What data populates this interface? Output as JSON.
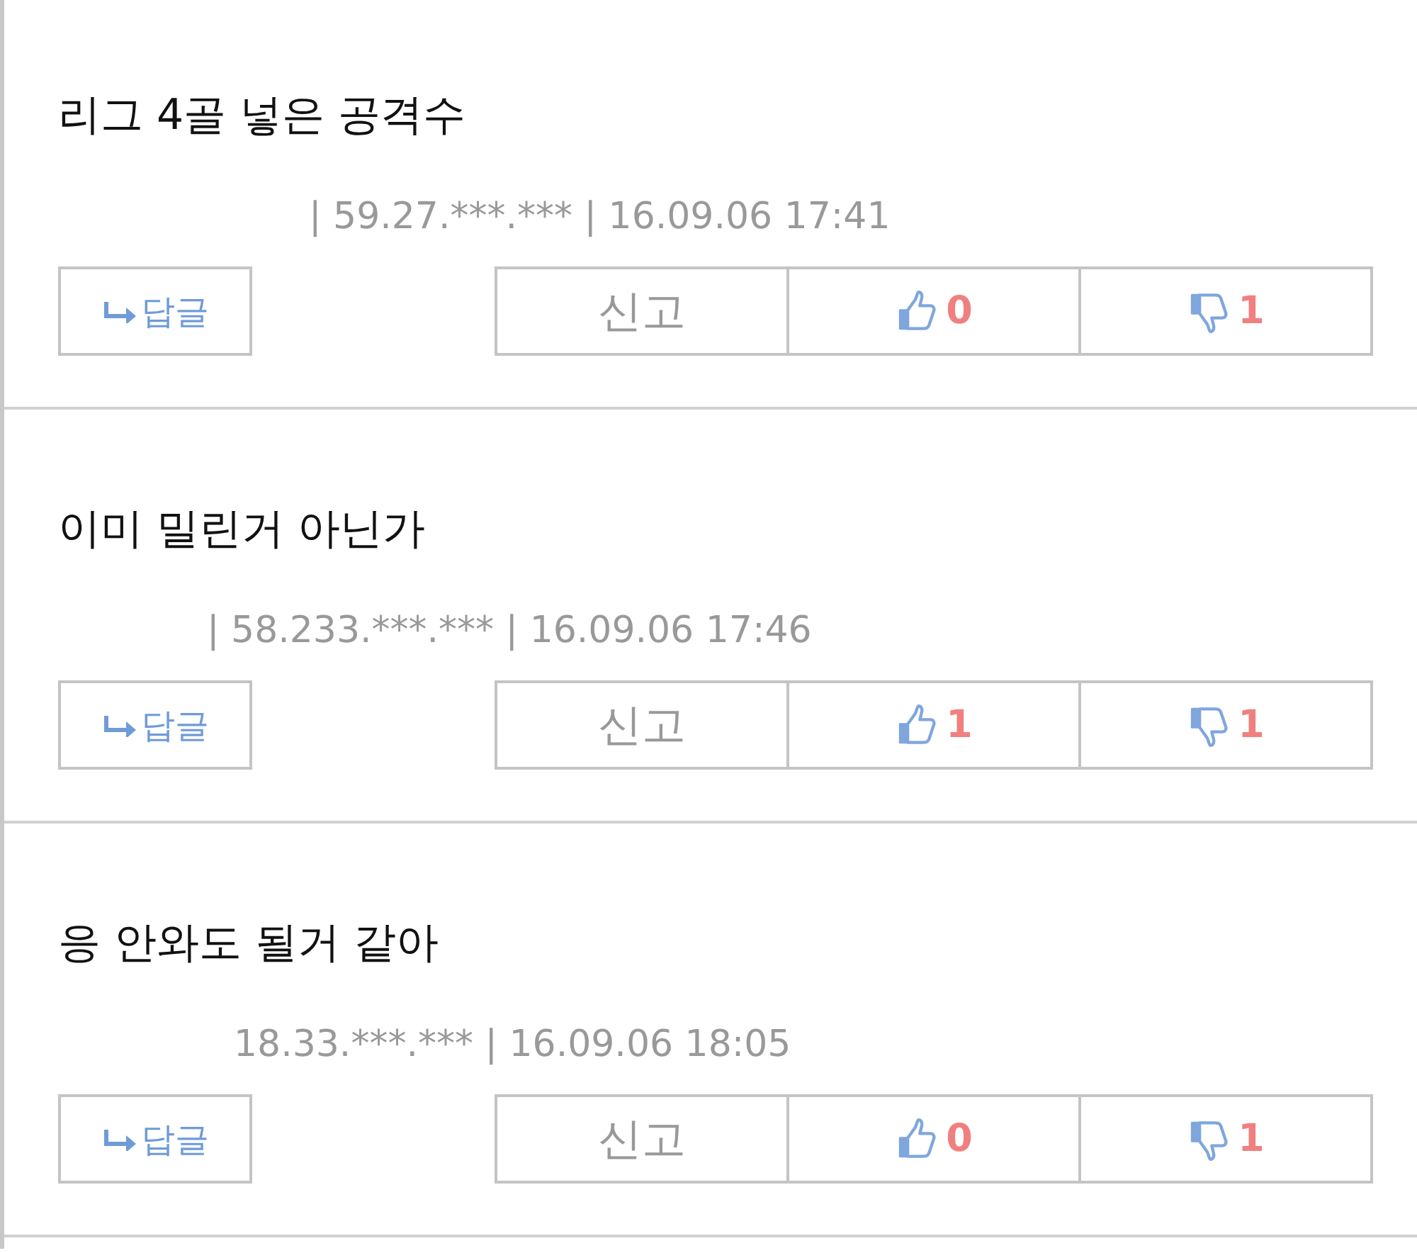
{
  "comments": [
    {
      "title": "리그 4골 넣은 공격수",
      "meta": "| 59.27.***.*** | 16.09.06 17:41",
      "reply": "답글",
      "report": "신고",
      "likes": "0",
      "dislikes": "1"
    },
    {
      "title": "이미 밀린거 아닌가",
      "meta": "| 58.233.***.*** | 16.09.06 17:46",
      "reply": "답글",
      "report": "신고",
      "likes": "1",
      "dislikes": "1"
    },
    {
      "title": "응 안와도 될거 같아",
      "meta": "18.33.***.*** | 16.09.06 18:05",
      "reply": "답글",
      "report": "신고",
      "likes": "0",
      "dislikes": "1"
    }
  ]
}
